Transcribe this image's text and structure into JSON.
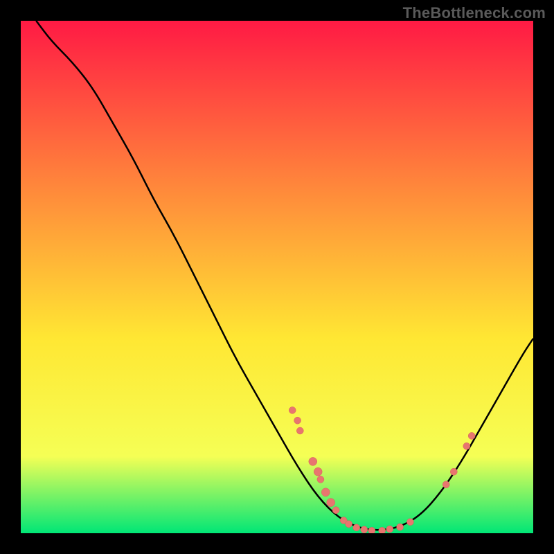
{
  "watermark": "TheBottleneck.com",
  "colors": {
    "background": "#000000",
    "gradient_top": "#ff1a44",
    "gradient_mid1": "#ff863b",
    "gradient_mid2": "#ffe733",
    "gradient_mid3": "#f5ff55",
    "gradient_bottom": "#00e676",
    "curve": "#000000",
    "marker_fill": "#e8766f",
    "marker_stroke": "#d95f59"
  },
  "chart_data": {
    "type": "line",
    "title": "",
    "xlabel": "",
    "ylabel": "",
    "xlim": [
      0,
      100
    ],
    "ylim": [
      0,
      100
    ],
    "curve": [
      {
        "x": 3,
        "y": 100
      },
      {
        "x": 6,
        "y": 96
      },
      {
        "x": 10,
        "y": 92
      },
      {
        "x": 14,
        "y": 87
      },
      {
        "x": 18,
        "y": 80
      },
      {
        "x": 22,
        "y": 73
      },
      {
        "x": 26,
        "y": 65
      },
      {
        "x": 30,
        "y": 58
      },
      {
        "x": 34,
        "y": 50
      },
      {
        "x": 38,
        "y": 42
      },
      {
        "x": 42,
        "y": 34
      },
      {
        "x": 46,
        "y": 27
      },
      {
        "x": 50,
        "y": 20
      },
      {
        "x": 54,
        "y": 13
      },
      {
        "x": 58,
        "y": 7
      },
      {
        "x": 62,
        "y": 3
      },
      {
        "x": 66,
        "y": 1
      },
      {
        "x": 70,
        "y": 0.5
      },
      {
        "x": 74,
        "y": 1.2
      },
      {
        "x": 78,
        "y": 3.5
      },
      {
        "x": 82,
        "y": 8
      },
      {
        "x": 86,
        "y": 14
      },
      {
        "x": 90,
        "y": 21
      },
      {
        "x": 94,
        "y": 28
      },
      {
        "x": 98,
        "y": 35
      },
      {
        "x": 100,
        "y": 38
      }
    ],
    "markers": [
      {
        "x": 53,
        "y": 24,
        "r": 5
      },
      {
        "x": 54,
        "y": 22,
        "r": 5
      },
      {
        "x": 54.5,
        "y": 20,
        "r": 5
      },
      {
        "x": 57,
        "y": 14,
        "r": 6
      },
      {
        "x": 58,
        "y": 12,
        "r": 6
      },
      {
        "x": 58.5,
        "y": 10.5,
        "r": 5
      },
      {
        "x": 59.5,
        "y": 8,
        "r": 6
      },
      {
        "x": 60.5,
        "y": 6,
        "r": 6
      },
      {
        "x": 61.5,
        "y": 4.5,
        "r": 5
      },
      {
        "x": 63,
        "y": 2.5,
        "r": 5
      },
      {
        "x": 64,
        "y": 1.8,
        "r": 5
      },
      {
        "x": 65.5,
        "y": 1.1,
        "r": 5
      },
      {
        "x": 67,
        "y": 0.7,
        "r": 5
      },
      {
        "x": 68.5,
        "y": 0.5,
        "r": 5
      },
      {
        "x": 70.5,
        "y": 0.5,
        "r": 5
      },
      {
        "x": 72,
        "y": 0.8,
        "r": 5
      },
      {
        "x": 74,
        "y": 1.2,
        "r": 5
      },
      {
        "x": 76,
        "y": 2.2,
        "r": 5
      },
      {
        "x": 83,
        "y": 9.5,
        "r": 5
      },
      {
        "x": 84.5,
        "y": 12,
        "r": 5
      },
      {
        "x": 87,
        "y": 17,
        "r": 5
      },
      {
        "x": 88,
        "y": 19,
        "r": 5
      }
    ]
  }
}
